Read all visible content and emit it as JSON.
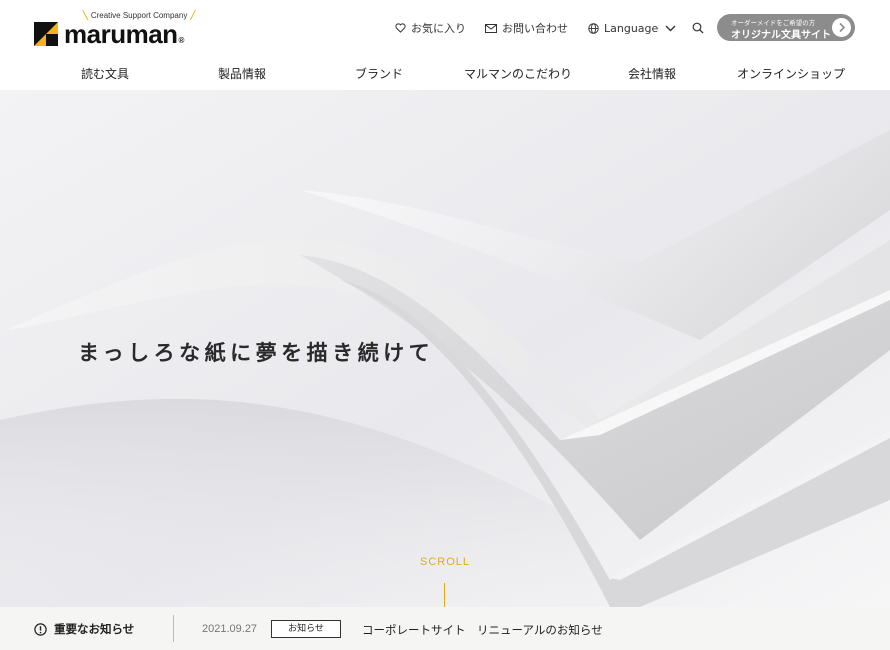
{
  "header": {
    "logo": {
      "tagline": "Creative Support Company",
      "wordmark": "maruman",
      "registered": "®"
    },
    "utility": {
      "favorites": "お気に入り",
      "contact": "お問い合わせ",
      "language": "Language"
    },
    "custom_order_button": {
      "sub_label": "オーダーメイドをご希望の方",
      "main_label": "オリジナル文具サイト"
    },
    "nav": [
      {
        "label": "読む文具"
      },
      {
        "label": "製品情報"
      },
      {
        "label": "ブランド"
      },
      {
        "label": "マルマンのこだわり"
      },
      {
        "label": "会社情報"
      },
      {
        "label": "オンラインショップ"
      }
    ]
  },
  "hero": {
    "catchcopy": "まっしろな紙に夢を描き続けて",
    "scroll_label": "SCROLL"
  },
  "news": {
    "heading": "重要なお知らせ",
    "date": "2021.09.27",
    "tag": "お知らせ",
    "title": "コーポレートサイト　リニューアルのお知らせ"
  },
  "colors": {
    "accent": "#e0a820",
    "logo_yellow": "#f2b418",
    "button_gray": "#8c8c8c"
  },
  "icons": [
    "heart-icon",
    "mail-icon",
    "globe-icon",
    "chevron-down-icon",
    "search-icon",
    "arrow-right-icon",
    "alert-icon"
  ]
}
